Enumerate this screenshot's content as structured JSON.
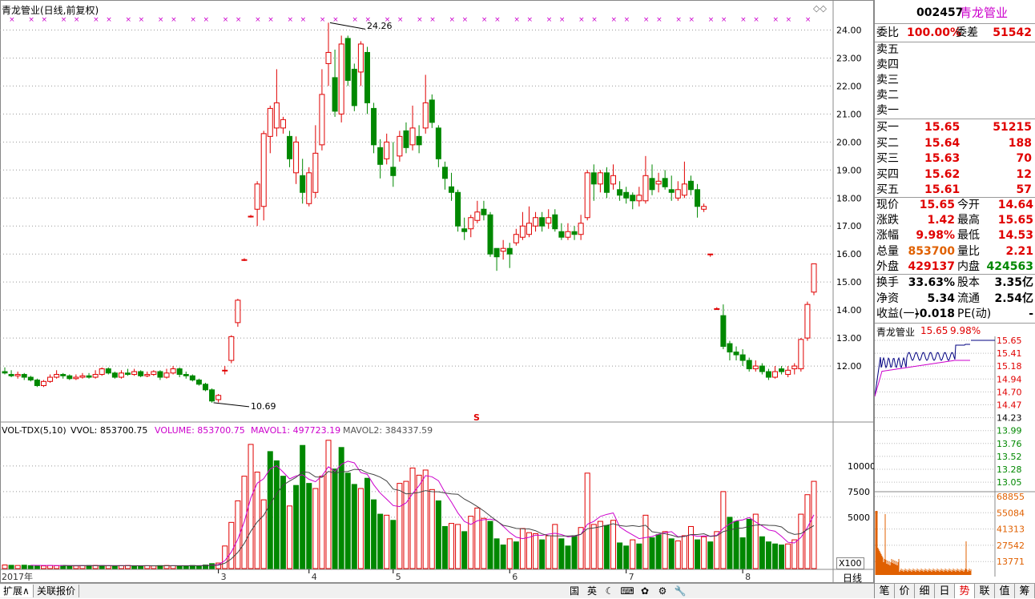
{
  "chart": {
    "title": "青龙管业(日线,前复权)",
    "high_label": "24.26",
    "low_label": "10.69",
    "s_marker": "S",
    "price_axis": [
      "24.00",
      "23.00",
      "22.00",
      "21.00",
      "20.00",
      "19.00",
      "18.00",
      "17.00",
      "16.00",
      "15.00",
      "14.00",
      "13.00",
      "12.00"
    ],
    "vol_header": {
      "name": "VOL-TDX(5,10)",
      "vvol": "VVOL: 853700.75",
      "volume": "VOLUME: 853700.75",
      "mavol1": "MAVOL1: 497723.19",
      "mavol2": "MAVOL2: 384337.59"
    },
    "vol_axis": [
      "10000",
      "7500",
      "5000"
    ],
    "vol_unit": "X100",
    "date_labels": [
      "2017年",
      "3",
      "4",
      "5",
      "6",
      "7",
      "8"
    ],
    "period": "日线",
    "colors": {
      "up": "#e00000",
      "down": "#008800",
      "ma1": "#cc00cc",
      "ma2": "#444444",
      "marker": "#cc00cc"
    }
  },
  "chart_data": {
    "type": "candlestick",
    "y_range": [
      10.2,
      24.5
    ],
    "candles": [
      [
        11.8,
        11.75,
        11.95,
        11.7
      ],
      [
        11.7,
        11.65,
        11.85,
        11.6
      ],
      [
        11.65,
        11.7,
        11.8,
        11.55
      ],
      [
        11.7,
        11.6,
        11.75,
        11.5
      ],
      [
        11.6,
        11.5,
        11.65,
        11.45
      ],
      [
        11.5,
        11.3,
        11.55,
        11.25
      ],
      [
        11.3,
        11.45,
        11.5,
        11.25
      ],
      [
        11.45,
        11.6,
        11.7,
        11.4
      ],
      [
        11.6,
        11.7,
        11.85,
        11.55
      ],
      [
        11.7,
        11.65,
        11.75,
        11.55
      ],
      [
        11.65,
        11.55,
        11.7,
        11.5
      ],
      [
        11.55,
        11.6,
        11.7,
        11.5
      ],
      [
        11.6,
        11.65,
        11.75,
        11.55
      ],
      [
        11.65,
        11.6,
        11.75,
        11.55
      ],
      [
        11.6,
        11.7,
        11.85,
        11.55
      ],
      [
        11.7,
        11.9,
        11.95,
        11.65
      ],
      [
        11.9,
        11.75,
        11.95,
        11.7
      ],
      [
        11.75,
        11.6,
        11.8,
        11.55
      ],
      [
        11.6,
        11.75,
        11.85,
        11.55
      ],
      [
        11.75,
        11.7,
        11.9,
        11.65
      ],
      [
        11.7,
        11.8,
        11.9,
        11.65
      ],
      [
        11.8,
        11.65,
        11.85,
        11.6
      ],
      [
        11.65,
        11.7,
        11.8,
        11.6
      ],
      [
        11.7,
        11.8,
        11.85,
        11.65
      ],
      [
        11.8,
        11.6,
        11.85,
        11.5
      ],
      [
        11.6,
        11.75,
        11.9,
        11.55
      ],
      [
        11.75,
        11.9,
        12.0,
        11.7
      ],
      [
        11.9,
        11.7,
        11.95,
        11.6
      ],
      [
        11.7,
        11.65,
        11.8,
        11.55
      ],
      [
        11.65,
        11.5,
        11.7,
        11.45
      ],
      [
        11.5,
        11.35,
        11.55,
        11.3
      ],
      [
        11.35,
        11.15,
        11.4,
        11.1
      ],
      [
        11.15,
        10.75,
        11.2,
        10.69
      ],
      [
        10.8,
        10.95,
        11.0,
        10.7
      ],
      [
        11.85,
        11.85,
        12.0,
        11.7
      ],
      [
        12.2,
        13.05,
        13.1,
        12.1
      ],
      [
        13.55,
        14.35,
        14.4,
        13.4
      ],
      [
        15.8,
        15.8,
        15.85,
        15.75
      ],
      [
        17.35,
        17.35,
        17.4,
        17.3
      ],
      [
        17.6,
        18.5,
        18.6,
        17.0
      ],
      [
        17.7,
        20.3,
        20.4,
        17.2
      ],
      [
        20.2,
        21.2,
        21.3,
        19.6
      ],
      [
        20.5,
        21.4,
        22.6,
        20.2
      ],
      [
        20.5,
        20.8,
        20.9,
        20.3
      ],
      [
        20.2,
        19.4,
        20.4,
        19.1
      ],
      [
        18.9,
        20.0,
        20.2,
        18.5
      ],
      [
        18.8,
        18.2,
        19.4,
        17.8
      ],
      [
        17.8,
        18.9,
        19.1,
        17.7
      ],
      [
        18.2,
        19.6,
        20.6,
        18.0
      ],
      [
        19.9,
        21.7,
        22.6,
        19.7
      ],
      [
        22.8,
        23.2,
        24.26,
        22.0
      ],
      [
        22.3,
        21.1,
        23.3,
        20.9
      ],
      [
        21.0,
        23.5,
        23.8,
        20.7
      ],
      [
        23.7,
        22.2,
        23.8,
        22.0
      ],
      [
        22.6,
        21.3,
        22.8,
        21.1
      ],
      [
        22.5,
        23.5,
        23.6,
        22.0
      ],
      [
        23.2,
        21.4,
        23.4,
        21.0
      ],
      [
        21.2,
        19.9,
        21.4,
        19.6
      ],
      [
        19.8,
        19.2,
        20.1,
        18.7
      ],
      [
        19.4,
        20.0,
        20.3,
        19.2
      ],
      [
        19.1,
        18.8,
        20.0,
        18.4
      ],
      [
        19.5,
        20.2,
        20.4,
        19.3
      ],
      [
        20.4,
        19.8,
        20.7,
        19.6
      ],
      [
        19.9,
        20.5,
        21.3,
        19.7
      ],
      [
        20.2,
        19.9,
        20.6,
        19.6
      ],
      [
        20.5,
        21.4,
        22.4,
        20.3
      ],
      [
        21.5,
        20.7,
        21.7,
        20.5
      ],
      [
        20.5,
        19.4,
        20.6,
        19.1
      ],
      [
        19.1,
        18.7,
        19.3,
        18.3
      ],
      [
        18.4,
        18.2,
        18.9,
        17.9
      ],
      [
        18.2,
        17.0,
        18.3,
        16.8
      ],
      [
        16.9,
        16.8,
        17.3,
        16.5
      ],
      [
        16.9,
        17.3,
        17.4,
        16.6
      ],
      [
        17.2,
        17.5,
        17.9,
        17.1
      ],
      [
        17.6,
        17.4,
        17.9,
        17.2
      ],
      [
        17.4,
        16.0,
        17.5,
        15.9
      ],
      [
        16.2,
        15.9,
        16.1,
        15.4
      ],
      [
        16.1,
        16.2,
        16.5,
        15.8
      ],
      [
        16.2,
        16.0,
        16.4,
        15.5
      ],
      [
        16.4,
        16.7,
        16.9,
        16.3
      ],
      [
        16.6,
        17.0,
        17.5,
        16.5
      ],
      [
        16.7,
        17.1,
        17.7,
        16.6
      ],
      [
        17.0,
        17.3,
        17.5,
        16.8
      ],
      [
        17.3,
        17.0,
        17.5,
        16.8
      ],
      [
        17.1,
        17.3,
        17.6,
        16.9
      ],
      [
        17.4,
        16.9,
        17.6,
        16.8
      ],
      [
        16.8,
        16.6,
        17.1,
        16.5
      ],
      [
        16.6,
        16.8,
        17.1,
        16.5
      ],
      [
        16.8,
        16.7,
        17.0,
        16.5
      ],
      [
        16.7,
        17.1,
        17.4,
        16.5
      ],
      [
        17.3,
        18.9,
        19.0,
        17.2
      ],
      [
        18.9,
        18.5,
        19.2,
        17.9
      ],
      [
        18.5,
        18.9,
        19.0,
        18.2
      ],
      [
        18.9,
        18.2,
        19.1,
        18.0
      ],
      [
        18.5,
        18.8,
        19.2,
        18.3
      ],
      [
        18.3,
        18.1,
        18.6,
        17.9
      ],
      [
        18.2,
        18.0,
        18.4,
        17.8
      ],
      [
        18.1,
        17.9,
        18.2,
        17.6
      ],
      [
        17.9,
        18.1,
        18.4,
        17.7
      ],
      [
        17.9,
        18.8,
        19.5,
        17.8
      ],
      [
        18.7,
        18.3,
        19.2,
        18.1
      ],
      [
        18.5,
        18.6,
        18.9,
        18.2
      ],
      [
        18.7,
        18.4,
        19.0,
        18.3
      ],
      [
        18.3,
        18.2,
        18.8,
        17.9
      ],
      [
        18.0,
        18.3,
        18.6,
        17.9
      ],
      [
        18.1,
        18.5,
        19.3,
        18.0
      ],
      [
        18.6,
        18.3,
        18.8,
        18.1
      ],
      [
        18.3,
        17.7,
        18.5,
        17.3
      ],
      [
        17.6,
        17.7,
        17.8,
        17.5
      ],
      [
        16.0,
        16.0,
        16.0,
        15.9
      ],
      [
        14.05,
        14.05,
        14.1,
        14.0
      ],
      [
        13.8,
        12.7,
        14.2,
        12.6
      ],
      [
        12.8,
        12.5,
        12.9,
        12.2
      ],
      [
        12.5,
        12.4,
        12.7,
        12.2
      ],
      [
        12.4,
        12.2,
        12.6,
        12.0
      ],
      [
        12.2,
        11.9,
        12.3,
        11.8
      ],
      [
        11.9,
        12.0,
        12.2,
        11.8
      ],
      [
        12.0,
        11.8,
        12.1,
        11.7
      ],
      [
        11.8,
        11.6,
        11.9,
        11.5
      ],
      [
        11.6,
        11.8,
        12.0,
        11.55
      ],
      [
        11.9,
        11.8,
        12.0,
        11.7
      ],
      [
        11.7,
        11.85,
        12.0,
        11.6
      ],
      [
        11.9,
        12.0,
        12.1,
        11.7
      ],
      [
        11.9,
        12.95,
        13.0,
        11.8
      ],
      [
        13.0,
        14.2,
        14.3,
        12.9
      ],
      [
        14.64,
        15.65,
        15.65,
        14.53
      ]
    ],
    "volumes": [
      [
        350,
        1
      ],
      [
        320,
        0
      ],
      [
        300,
        1
      ],
      [
        330,
        0
      ],
      [
        290,
        0
      ],
      [
        310,
        0
      ],
      [
        260,
        1
      ],
      [
        300,
        1
      ],
      [
        280,
        1
      ],
      [
        300,
        0
      ],
      [
        270,
        0
      ],
      [
        260,
        1
      ],
      [
        280,
        1
      ],
      [
        300,
        0
      ],
      [
        310,
        1
      ],
      [
        290,
        0
      ],
      [
        270,
        1
      ],
      [
        260,
        0
      ],
      [
        280,
        1
      ],
      [
        300,
        1
      ],
      [
        270,
        0
      ],
      [
        250,
        0
      ],
      [
        280,
        1
      ],
      [
        260,
        1
      ],
      [
        290,
        0
      ],
      [
        300,
        1
      ],
      [
        280,
        1
      ],
      [
        260,
        0
      ],
      [
        270,
        0
      ],
      [
        300,
        0
      ],
      [
        280,
        0
      ],
      [
        350,
        0
      ],
      [
        480,
        0
      ],
      [
        540,
        1
      ],
      [
        2200,
        1
      ],
      [
        4500,
        1
      ],
      [
        6600,
        1
      ],
      [
        9000,
        1
      ],
      [
        12100,
        1
      ],
      [
        9400,
        1
      ],
      [
        6700,
        1
      ],
      [
        11400,
        0
      ],
      [
        10500,
        0
      ],
      [
        9000,
        0
      ],
      [
        6100,
        1
      ],
      [
        8100,
        0
      ],
      [
        12000,
        0
      ],
      [
        8300,
        0
      ],
      [
        7800,
        1
      ],
      [
        9000,
        1
      ],
      [
        12500,
        1
      ],
      [
        9700,
        0
      ],
      [
        11800,
        0
      ],
      [
        9300,
        0
      ],
      [
        8200,
        0
      ],
      [
        7800,
        1
      ],
      [
        8800,
        0
      ],
      [
        6700,
        0
      ],
      [
        5300,
        0
      ],
      [
        5200,
        1
      ],
      [
        4700,
        0
      ],
      [
        8300,
        1
      ],
      [
        8500,
        1
      ],
      [
        9800,
        1
      ],
      [
        9100,
        1
      ],
      [
        9600,
        1
      ],
      [
        7700,
        1
      ],
      [
        6600,
        0
      ],
      [
        4100,
        0
      ],
      [
        4400,
        1
      ],
      [
        4300,
        1
      ],
      [
        3600,
        0
      ],
      [
        5100,
        1
      ],
      [
        5900,
        1
      ],
      [
        4900,
        1
      ],
      [
        4600,
        0
      ],
      [
        2900,
        0
      ],
      [
        2300,
        0
      ],
      [
        2900,
        1
      ],
      [
        2600,
        0
      ],
      [
        3900,
        1
      ],
      [
        3500,
        1
      ],
      [
        3400,
        1
      ],
      [
        2800,
        0
      ],
      [
        3200,
        1
      ],
      [
        4300,
        1
      ],
      [
        2900,
        0
      ],
      [
        2200,
        0
      ],
      [
        3200,
        0
      ],
      [
        4000,
        1
      ],
      [
        9300,
        1
      ],
      [
        4300,
        1
      ],
      [
        4600,
        1
      ],
      [
        4200,
        0
      ],
      [
        4700,
        1
      ],
      [
        2500,
        0
      ],
      [
        2200,
        0
      ],
      [
        2800,
        1
      ],
      [
        2400,
        0
      ],
      [
        5200,
        1
      ],
      [
        3000,
        0
      ],
      [
        3300,
        0
      ],
      [
        3600,
        1
      ],
      [
        2900,
        0
      ],
      [
        2700,
        1
      ],
      [
        3200,
        1
      ],
      [
        4100,
        1
      ],
      [
        2800,
        0
      ],
      [
        3100,
        1
      ],
      [
        2600,
        0
      ],
      [
        3600,
        1
      ],
      [
        7500,
        1
      ],
      [
        5000,
        0
      ],
      [
        4600,
        0
      ],
      [
        3000,
        0
      ],
      [
        4800,
        0
      ],
      [
        5300,
        1
      ],
      [
        3100,
        0
      ],
      [
        2600,
        0
      ],
      [
        2400,
        0
      ],
      [
        2300,
        0
      ],
      [
        2400,
        1
      ],
      [
        2800,
        1
      ],
      [
        5300,
        1
      ],
      [
        7200,
        1
      ],
      [
        8500,
        1
      ]
    ],
    "vol_max": 12500
  },
  "side": {
    "code": "002457",
    "name": "青龙管业",
    "weibi_label": "委比",
    "weibi": "100.00%",
    "weicha_label": "委差",
    "weicha": "51542",
    "sells": [
      "卖五",
      "卖四",
      "卖三",
      "卖二",
      "卖一"
    ],
    "buys": [
      {
        "label": "买一",
        "price": "15.65",
        "vol": "51215"
      },
      {
        "label": "买二",
        "price": "15.64",
        "vol": "188"
      },
      {
        "label": "买三",
        "price": "15.63",
        "vol": "70"
      },
      {
        "label": "买四",
        "price": "15.62",
        "vol": "12"
      },
      {
        "label": "买五",
        "price": "15.61",
        "vol": "57"
      }
    ],
    "quote": [
      {
        "l1": "现价",
        "v1": "15.65",
        "l2": "今开",
        "v2": "14.64"
      },
      {
        "l1": "涨跌",
        "v1": "1.42",
        "l2": "最高",
        "v2": "15.65"
      },
      {
        "l1": "涨幅",
        "v1": "9.98%",
        "l2": "最低",
        "v2": "14.53"
      },
      {
        "l1": "总量",
        "v1": "853700",
        "l2": "量比",
        "v2": "2.21"
      },
      {
        "l1": "外盘",
        "v1": "429137",
        "l2": "内盘",
        "v2": "424563"
      }
    ],
    "fund": [
      {
        "l1": "换手",
        "v1": "33.63%",
        "l2": "股本",
        "v2": "3.35亿"
      },
      {
        "l1": "净资",
        "v1": "5.34",
        "l2": "流通",
        "v2": "2.54亿"
      },
      {
        "l1": "收益(一)",
        "v1": "-0.018",
        "l2": "PE(动)",
        "v2": "-"
      }
    ],
    "mini_title": "青龙管业",
    "mini_price": "15.65",
    "mini_pct": "9.98%",
    "mini_price_axis": [
      "15.65",
      "15.41",
      "15.18",
      "14.94",
      "14.70",
      "14.47",
      "14.23",
      "13.99",
      "13.76",
      "13.52",
      "13.28",
      "13.05"
    ],
    "mini_vol_axis": [
      "68855",
      "55084",
      "41313",
      "27542",
      "13771"
    ],
    "tabs": [
      "笔",
      "价",
      "细",
      "日",
      "势",
      "联",
      "值",
      "筹"
    ]
  },
  "bottom": {
    "tabs": [
      "扩展∧",
      "关联报价"
    ],
    "icons": [
      "国",
      "英",
      "☾",
      "⌨",
      "✿",
      "⚙",
      "🔧"
    ]
  }
}
